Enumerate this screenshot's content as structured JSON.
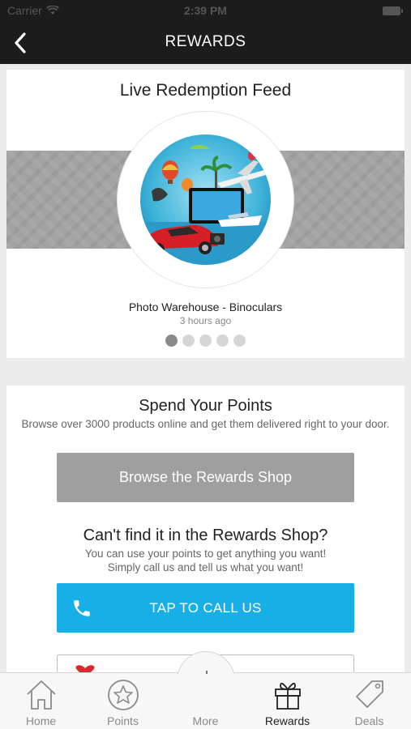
{
  "status_bar": {
    "carrier": "Carrier",
    "time": "2:39 PM"
  },
  "nav": {
    "title": "REWARDS",
    "back_icon": "chevron-left-icon"
  },
  "feed": {
    "title": "Live Redemption Feed",
    "item_name": "Photo Warehouse - Binoculars",
    "item_time": "3 hours ago",
    "slides": 5,
    "active_slide": 1
  },
  "spend": {
    "title": "Spend Your Points",
    "description": "Browse over 3000 products online and get them delivered right to your door.",
    "browse_button": "Browse the Rewards Shop",
    "cant_find_title": "Can't find it in the Rewards Shop?",
    "cant_find_line1": "You can use your points to get anything you want!",
    "cant_find_line2": "Simply call us and tell us what you want!",
    "call_button": "TAP TO CALL US"
  },
  "tabs": [
    {
      "label": "Home",
      "icon": "home-icon"
    },
    {
      "label": "Points",
      "icon": "star-icon"
    },
    {
      "label": "More",
      "icon": "plus-icon"
    },
    {
      "label": "Rewards",
      "icon": "gift-icon"
    },
    {
      "label": "Deals",
      "icon": "tag-icon"
    }
  ],
  "active_tab": "Rewards",
  "colors": {
    "call_button": "#18aee6",
    "browse_button": "#9f9f9f",
    "nav_bg": "#1c1c1c"
  }
}
